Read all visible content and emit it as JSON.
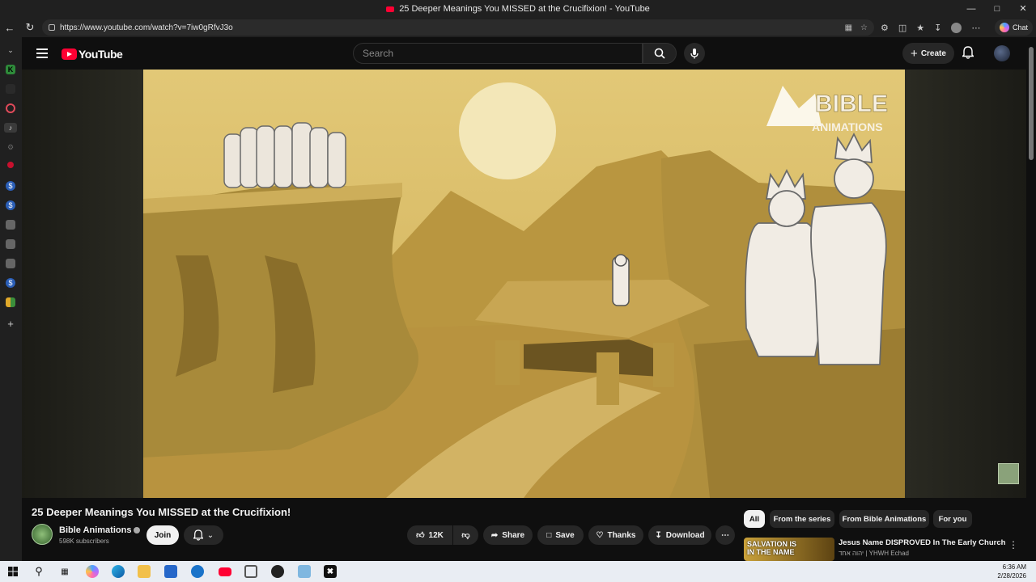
{
  "browser": {
    "tab_title": "25 Deeper Meanings You MISSED at the Crucifixion! - YouTube",
    "url": "https://www.youtube.com/watch?v=7iw0gRfvJ3o",
    "chat_label": "Chat"
  },
  "header": {
    "logo_text": "YouTube",
    "search_placeholder": "Search",
    "create_label": "Create"
  },
  "video": {
    "title": "25 Deeper Meanings You MISSED at the Crucifixion!",
    "watermark_line1": "BIBLE",
    "watermark_line2": "ANIMATIONS"
  },
  "channel": {
    "name": "Bible Animations",
    "subscribers": "598K subscribers",
    "join_label": "Join"
  },
  "actions": {
    "likes": "12K",
    "share": "Share",
    "save": "Save",
    "thanks": "Thanks",
    "download": "Download"
  },
  "chips": [
    "All",
    "From the series",
    "From Bible Animations",
    "For you"
  ],
  "recommendation": {
    "thumb_text_1": "SALVATION IS",
    "thumb_text_2": "IN THE NAME",
    "title": "Jesus Name DISPROVED In The Early Church",
    "channel": "יהוה אחד | YHWH Echad"
  },
  "taskbar": {
    "time": "6:36 AM",
    "date": "2/28/2026"
  }
}
